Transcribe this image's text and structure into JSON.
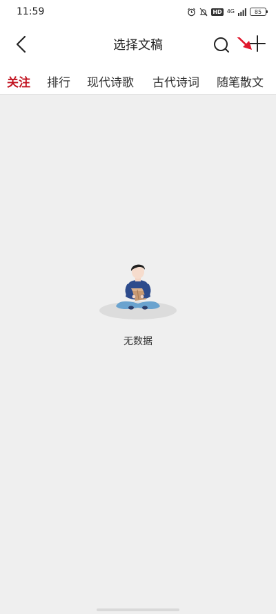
{
  "status_bar": {
    "time": "11:59",
    "icons": [
      "alarm-icon",
      "mute-icon",
      "hd-icon",
      "network-4g-icon",
      "signal-icon",
      "battery-icon"
    ],
    "hd_label": "HD",
    "network_label": "4G",
    "battery_level": "85"
  },
  "navbar": {
    "title": "选择文稿",
    "back_icon": "chevron-left-icon",
    "search_icon": "search-icon",
    "add_icon": "plus-icon"
  },
  "tabs": [
    {
      "label": "关注",
      "active": true
    },
    {
      "label": "排行",
      "active": false
    },
    {
      "label": "现代诗歌",
      "active": false
    },
    {
      "label": "古代诗词",
      "active": false
    },
    {
      "label": "随笔散文",
      "active": false
    }
  ],
  "empty_state": {
    "icon": "person-with-box-illustration",
    "message": "无数据"
  },
  "colors": {
    "accent": "#c1121f",
    "background": "#efefef",
    "annotation_arrow": "#e0182d"
  }
}
